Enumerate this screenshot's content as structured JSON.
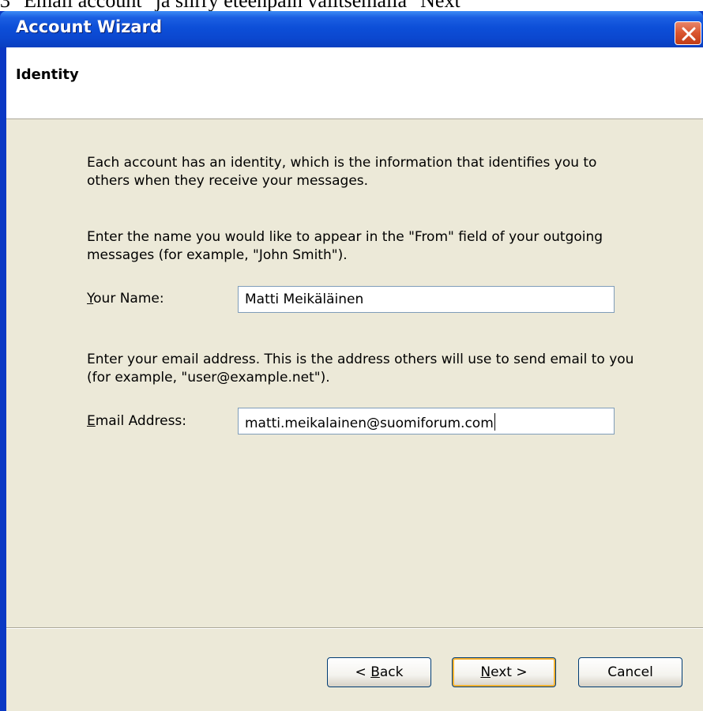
{
  "caption": "3 \"Email account\" ja siirry eteenpäin valitsemalla \"Next\"",
  "window": {
    "title": "Account Wizard",
    "close_icon": "close-icon"
  },
  "page": {
    "title": "Identity",
    "intro": "Each account has an identity, which is the information that identifies you to others when they receive your messages.",
    "name_instructions": "Enter the name you would like to appear in the \"From\" field of your outgoing messages (for example, \"John Smith\").",
    "email_instructions": "Enter your email address. This is the address others will use to send email to you (for example, \"user@example.net\")."
  },
  "fields": {
    "name": {
      "label_key": "Y",
      "label_rest": "our Name:",
      "value": "Matti Meikäläinen"
    },
    "email": {
      "label_key": "E",
      "label_rest": "mail Address:",
      "value": "matti.meikalainen@suomiforum.com"
    }
  },
  "buttons": {
    "back": {
      "prefix": "< ",
      "key": "B",
      "rest": "ack"
    },
    "next": {
      "key": "N",
      "rest": "ext >"
    },
    "cancel": {
      "label": "Cancel"
    }
  },
  "colors": {
    "titlebar": "#0b47cf",
    "client_bg": "#ece9d8",
    "close_button": "#d9542e",
    "default_button_ring": "#f8b332"
  }
}
